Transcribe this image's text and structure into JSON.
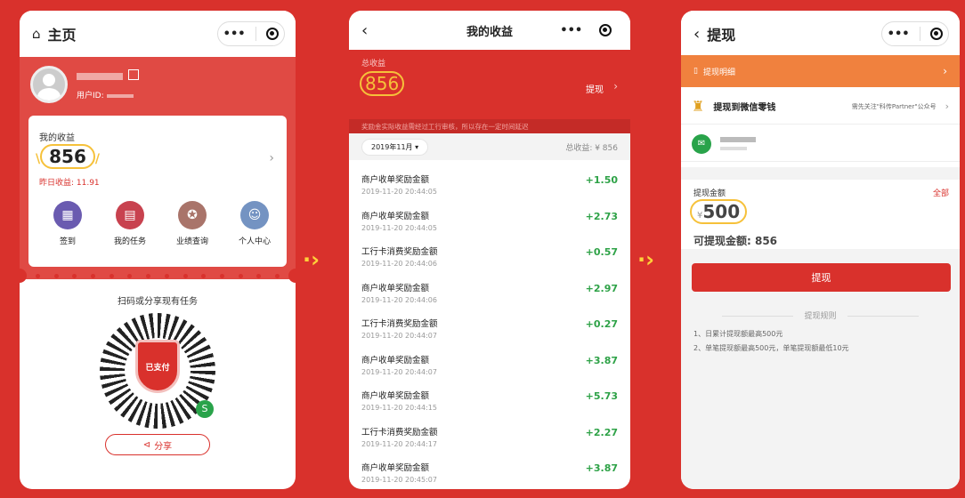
{
  "p1": {
    "title": "主页",
    "uid_label": "用户ID:",
    "earnings_label": "我的收益",
    "earnings": "856",
    "yesterday": "昨日收益: 11.91",
    "actions": [
      "签到",
      "我的任务",
      "业绩查询",
      "个人中心"
    ],
    "scan_text": "扫码或分享现有任务",
    "shield_text": "已支付",
    "share": "分享"
  },
  "p2": {
    "title": "我的收益",
    "total_label": "总收益",
    "total": "856",
    "withdraw": "提现",
    "notice": "奖励金实际收益需经过工行审核，所以存在一定时间延迟",
    "month": "2019年11月 ▾",
    "total_sum": "总收益: ¥ 856",
    "records": [
      {
        "title": "商户收单奖励金额",
        "date": "2019-11-20 20:44:05",
        "amount": "+1.50"
      },
      {
        "title": "商户收单奖励金额",
        "date": "2019-11-20 20:44:05",
        "amount": "+2.73"
      },
      {
        "title": "工行卡消费奖励金额",
        "date": "2019-11-20 20:44:06",
        "amount": "+0.57"
      },
      {
        "title": "商户收单奖励金额",
        "date": "2019-11-20 20:44:06",
        "amount": "+2.97"
      },
      {
        "title": "工行卡消费奖励金额",
        "date": "2019-11-20 20:44:07",
        "amount": "+0.27"
      },
      {
        "title": "商户收单奖励金额",
        "date": "2019-11-20 20:44:07",
        "amount": "+3.87"
      },
      {
        "title": "商户收单奖励金额",
        "date": "2019-11-20 20:44:15",
        "amount": "+5.73"
      },
      {
        "title": "工行卡消费奖励金额",
        "date": "2019-11-20 20:44:17",
        "amount": "+2.27"
      },
      {
        "title": "商户收单奖励金额",
        "date": "2019-11-20 20:45:07",
        "amount": "+3.87"
      }
    ]
  },
  "p3": {
    "title": "提现",
    "detail": "提现明细",
    "to_wechat": "提现到微信零钱",
    "hint": "需先关注\"科传Partner\"公众号",
    "amount_label": "提现金额",
    "all": "全部",
    "currency": "¥",
    "amount": "500",
    "available": "可提现金额: 856",
    "button": "提现",
    "rules_title": "提现规则",
    "rule1": "1、日累计提现额最高500元",
    "rule2": "2、单笔提现额最高500元，单笔提现额最低10元"
  }
}
